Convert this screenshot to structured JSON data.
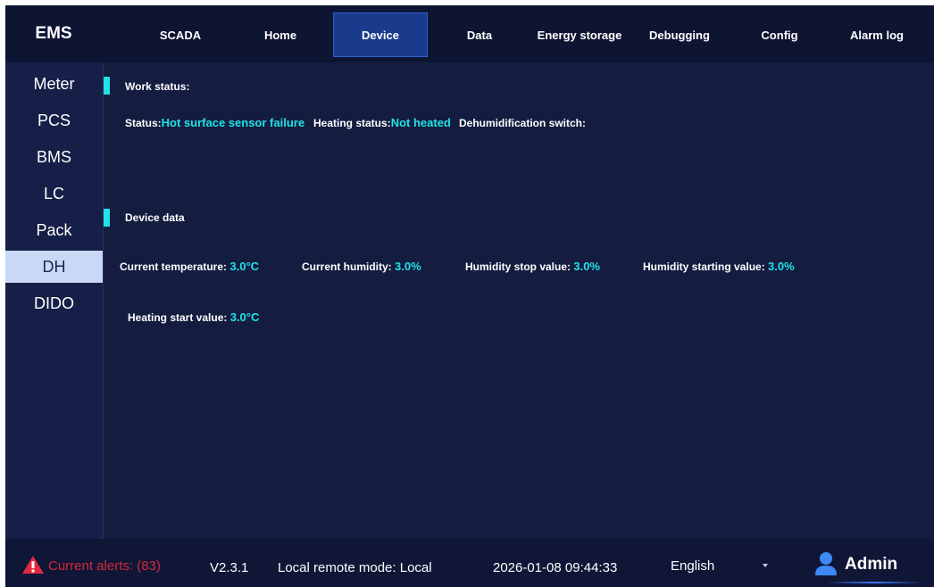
{
  "header": {
    "brand": "EMS",
    "tabs": [
      {
        "label": "SCADA"
      },
      {
        "label": "Home"
      },
      {
        "label": "Device"
      },
      {
        "label": "Data"
      },
      {
        "label": "Energy storage"
      },
      {
        "label": "Debugging"
      },
      {
        "label": "Config"
      },
      {
        "label": "Alarm log"
      }
    ],
    "active_tab": "Device"
  },
  "sidebar": {
    "items": [
      {
        "label": "Meter"
      },
      {
        "label": "PCS"
      },
      {
        "label": "BMS"
      },
      {
        "label": "LC"
      },
      {
        "label": "Pack"
      },
      {
        "label": "DH"
      },
      {
        "label": "DIDO"
      }
    ],
    "active_item": "DH"
  },
  "work_status": {
    "title": "Work status:",
    "status_label": "Status:",
    "status_value": "Hot surface sensor failure",
    "heating_label": "Heating status:",
    "heating_value": "Not heated",
    "dehumid_label": "Dehumidification switch:",
    "dehumid_value": ""
  },
  "device_data": {
    "title": "Device data",
    "current_temp_label": "Current temperature:",
    "current_temp_value": "3.0°C",
    "current_humidity_label": "Current humidity:",
    "current_humidity_value": "3.0%",
    "humidity_stop_label": "Humidity stop value:",
    "humidity_stop_value": "3.0%",
    "humidity_start_label": "Humidity starting value:",
    "humidity_start_value": "3.0%",
    "heating_start_label": "Heating start value:",
    "heating_start_value": "3.0°C"
  },
  "footer": {
    "alerts": "Current alerts: (83)",
    "version": "V2.3.1",
    "mode": "Local remote mode: Local",
    "datetime": "2026-01-08 09:44:33",
    "language": "English",
    "user": "Admin"
  },
  "colors": {
    "background": "#141c40",
    "accent": "#1fe3e8",
    "alert": "#d5283a",
    "active_tab": "#1a3a8c"
  }
}
